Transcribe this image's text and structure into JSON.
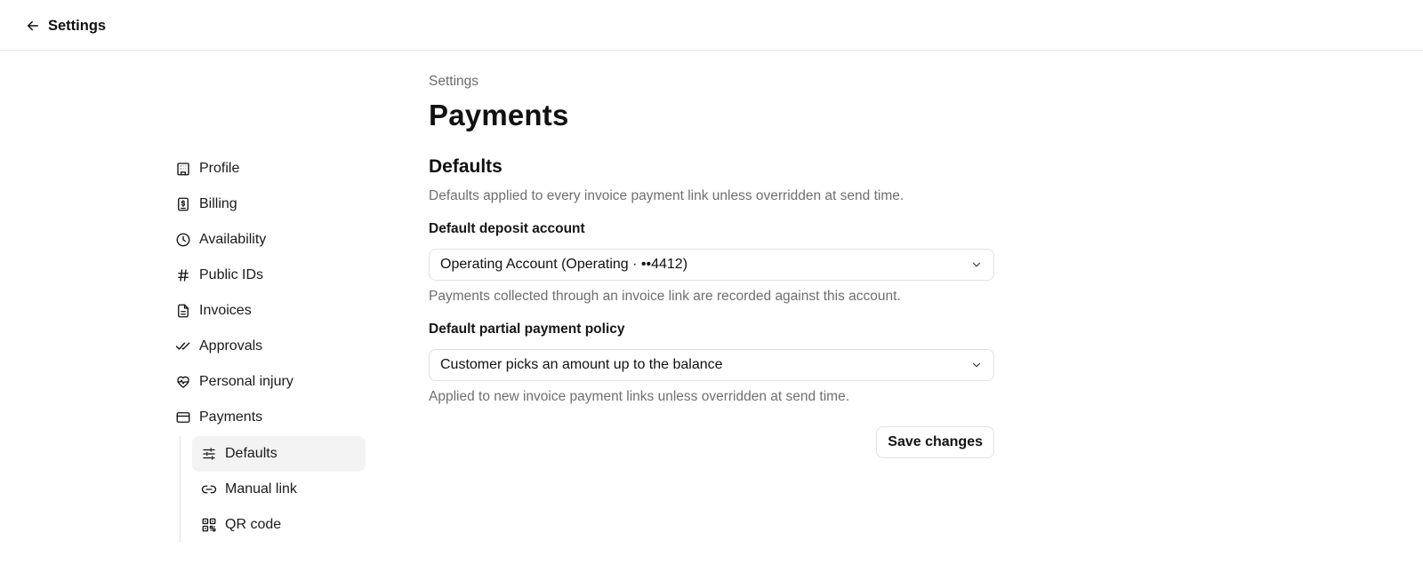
{
  "header": {
    "back_label": "Settings",
    "back_icon": "arrow-left-icon"
  },
  "sidebar": {
    "items": [
      {
        "label": "Profile",
        "icon": "building-icon"
      },
      {
        "label": "Billing",
        "icon": "dollar-receipt-icon"
      },
      {
        "label": "Availability",
        "icon": "clock-icon"
      },
      {
        "label": "Public IDs",
        "icon": "hash-icon"
      },
      {
        "label": "Invoices",
        "icon": "document-icon"
      },
      {
        "label": "Approvals",
        "icon": "double-check-icon"
      },
      {
        "label": "Personal injury",
        "icon": "heart-pulse-icon"
      },
      {
        "label": "Payments",
        "icon": "credit-card-icon"
      }
    ],
    "subitems": [
      {
        "label": "Defaults",
        "icon": "sliders-icon",
        "active": true
      },
      {
        "label": "Manual link",
        "icon": "link-icon"
      },
      {
        "label": "QR code",
        "icon": "qr-code-icon"
      }
    ]
  },
  "main": {
    "breadcrumb": "Settings",
    "title": "Payments",
    "section_title": "Defaults",
    "section_desc": "Defaults applied to every invoice payment link unless overridden at send time.",
    "deposit": {
      "label": "Default deposit account",
      "value": "Operating Account (Operating · ••4412)",
      "help": "Payments collected through an invoice link are recorded against this account."
    },
    "partial": {
      "label": "Default partial payment policy",
      "value": "Customer picks an amount up to the balance",
      "help": "Applied to new invoice payment links unless overridden at send time."
    },
    "save_label": "Save changes"
  }
}
